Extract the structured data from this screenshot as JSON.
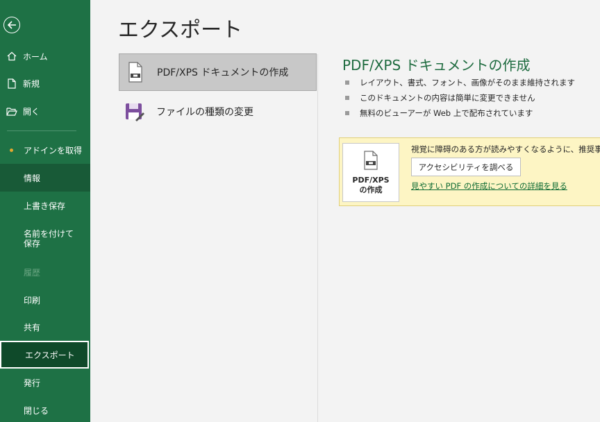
{
  "sidebar": {
    "back_icon": "back-arrow-icon",
    "home": "ホーム",
    "new": "新規",
    "open": "開く",
    "addins": "アドインを取得",
    "info": "情報",
    "save": "上書き保存",
    "save_as": "名前を付けて保存",
    "history": "履歴",
    "print": "印刷",
    "share": "共有",
    "export": "エクスポート",
    "publish": "発行",
    "close": "閉じる"
  },
  "main": {
    "title": "エクスポート",
    "options": [
      {
        "label": "PDF/XPS ドキュメントの作成",
        "icon": "pdf-document-icon"
      },
      {
        "label": "ファイルの種類の変更",
        "icon": "save-as-type-icon"
      }
    ]
  },
  "detail": {
    "title": "PDF/XPS ドキュメントの作成",
    "bullets": [
      "レイアウト、書式、フォント、画像がそのまま維持されます",
      "このドキュメントの内容は簡単に変更できません",
      "無料のビューアーが Web 上で配布されています"
    ],
    "notice_text": "視覚に障碍のある方が読みやすくなるように、推奨事項が適",
    "check_button": "アクセシビリティを調べる",
    "link": "見やすい PDF の作成についての詳細を見る",
    "pdf_button_line1": "PDF/XPS",
    "pdf_button_line2": "の作成"
  },
  "colors": {
    "sidebar_bg": "#1e7145",
    "accent_title": "#1e6b3f",
    "notice_bg": "#fdf5c4"
  }
}
